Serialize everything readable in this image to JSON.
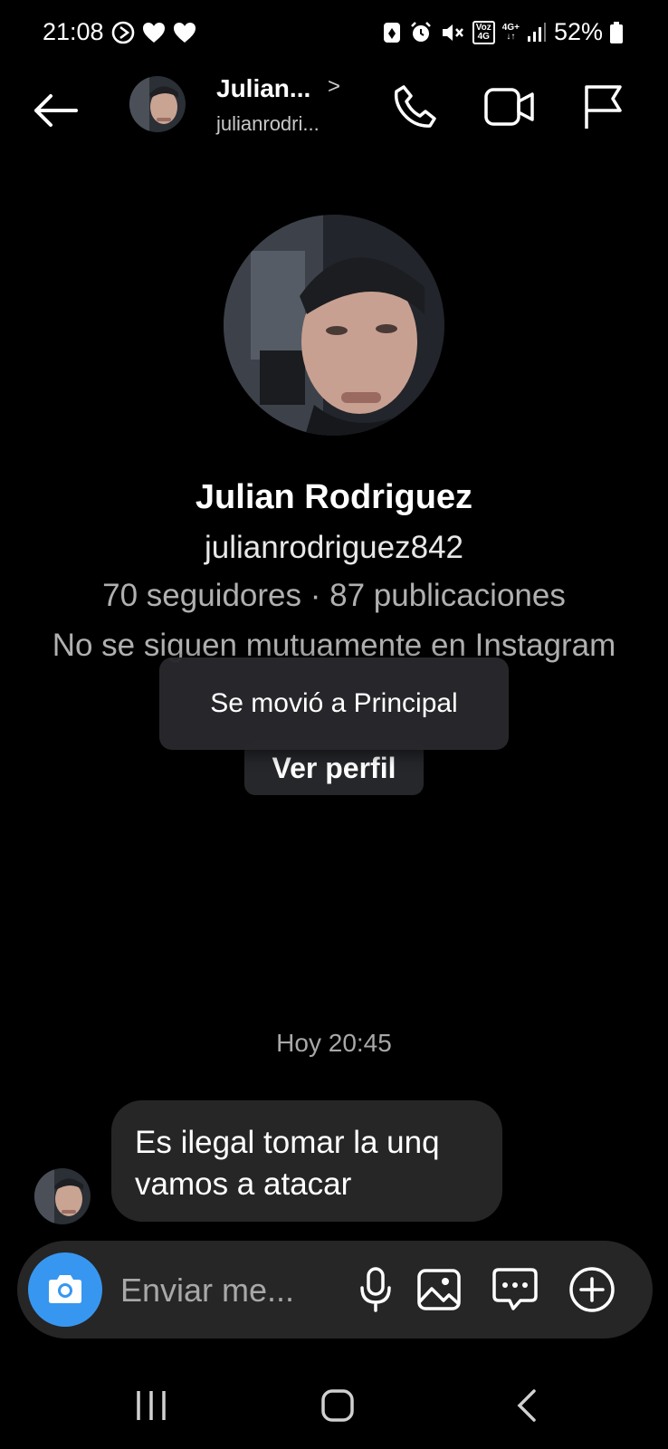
{
  "status_bar": {
    "time": "21:08",
    "network_top": "Voz",
    "network_bottom": "4G",
    "data_top": "4G+",
    "battery": "52%"
  },
  "header": {
    "name": "Julian...",
    "username": "julianrodri..."
  },
  "profile": {
    "name": "Julian Rodriguez",
    "username": "julianrodriguez842",
    "stats": "70 seguidores · 87 publicaciones",
    "mutual": "No se siguen mutuamente en Instagram",
    "view_profile_label": "Ver perfil"
  },
  "toast": {
    "text": "Se movió a Principal"
  },
  "chat": {
    "timestamp": "Hoy 20:45",
    "messages": [
      {
        "text": "Es ilegal tomar la unq vamos a atacar"
      }
    ]
  },
  "composer": {
    "placeholder": "Enviar me..."
  },
  "icons": {
    "back": "arrow-left-icon",
    "call": "phone-icon",
    "video": "video-camera-icon",
    "report": "flag-icon",
    "camera": "camera-icon",
    "mic": "microphone-icon",
    "gallery": "image-icon",
    "sticker": "chat-bubble-icon",
    "more": "plus-circle-icon"
  },
  "colors": {
    "accent": "#3797f0",
    "bubble": "#262626",
    "background": "#000000"
  }
}
